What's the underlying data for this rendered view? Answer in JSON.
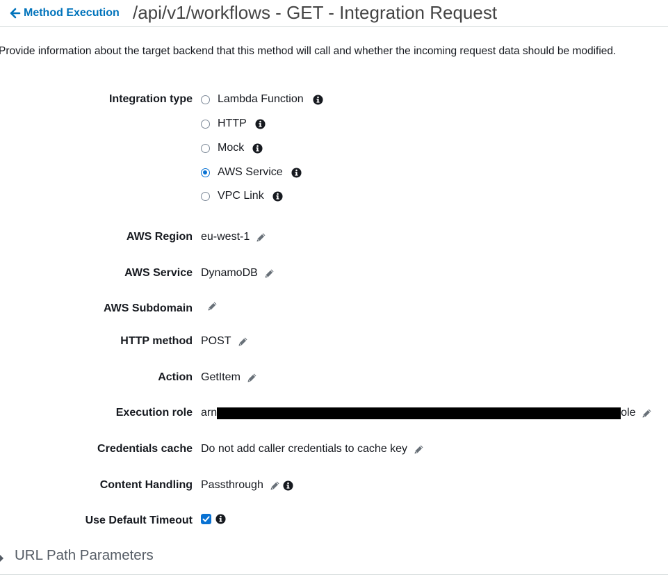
{
  "header": {
    "back_label": "Method Execution",
    "title": "/api/v1/workflows - GET - Integration Request"
  },
  "description": "Provide information about the target backend that this method will call and whether the incoming request data should be modified.",
  "integration_type": {
    "label": "Integration type",
    "options": [
      {
        "label": "Lambda Function",
        "checked": false
      },
      {
        "label": "HTTP",
        "checked": false
      },
      {
        "label": "Mock",
        "checked": false
      },
      {
        "label": "AWS Service",
        "checked": true
      },
      {
        "label": "VPC Link",
        "checked": false
      }
    ]
  },
  "fields": {
    "region": {
      "label": "AWS Region",
      "value": "eu-west-1"
    },
    "service": {
      "label": "AWS Service",
      "value": "DynamoDB"
    },
    "subdomain": {
      "label": "AWS Subdomain",
      "value": ""
    },
    "http_method": {
      "label": "HTTP method",
      "value": "POST"
    },
    "action": {
      "label": "Action",
      "value": "GetItem"
    },
    "execution_role": {
      "label": "Execution role",
      "value_prefix": "arn",
      "value_suffix": "ole"
    },
    "credentials_cache": {
      "label": "Credentials cache",
      "value": "Do not add caller credentials to cache key"
    },
    "content_handling": {
      "label": "Content Handling",
      "value": "Passthrough"
    },
    "default_timeout": {
      "label": "Use Default Timeout",
      "checked": true
    }
  },
  "sections": {
    "url_path_parameters": "URL Path Parameters"
  },
  "colors": {
    "link": "#0073bb",
    "accent": "#0972d3",
    "icon": "#16191f",
    "pencil": "#687078"
  },
  "icons": {
    "back": "arrow-left-icon",
    "info": "info-icon",
    "edit": "pencil-icon",
    "expand": "caret-right-icon"
  }
}
